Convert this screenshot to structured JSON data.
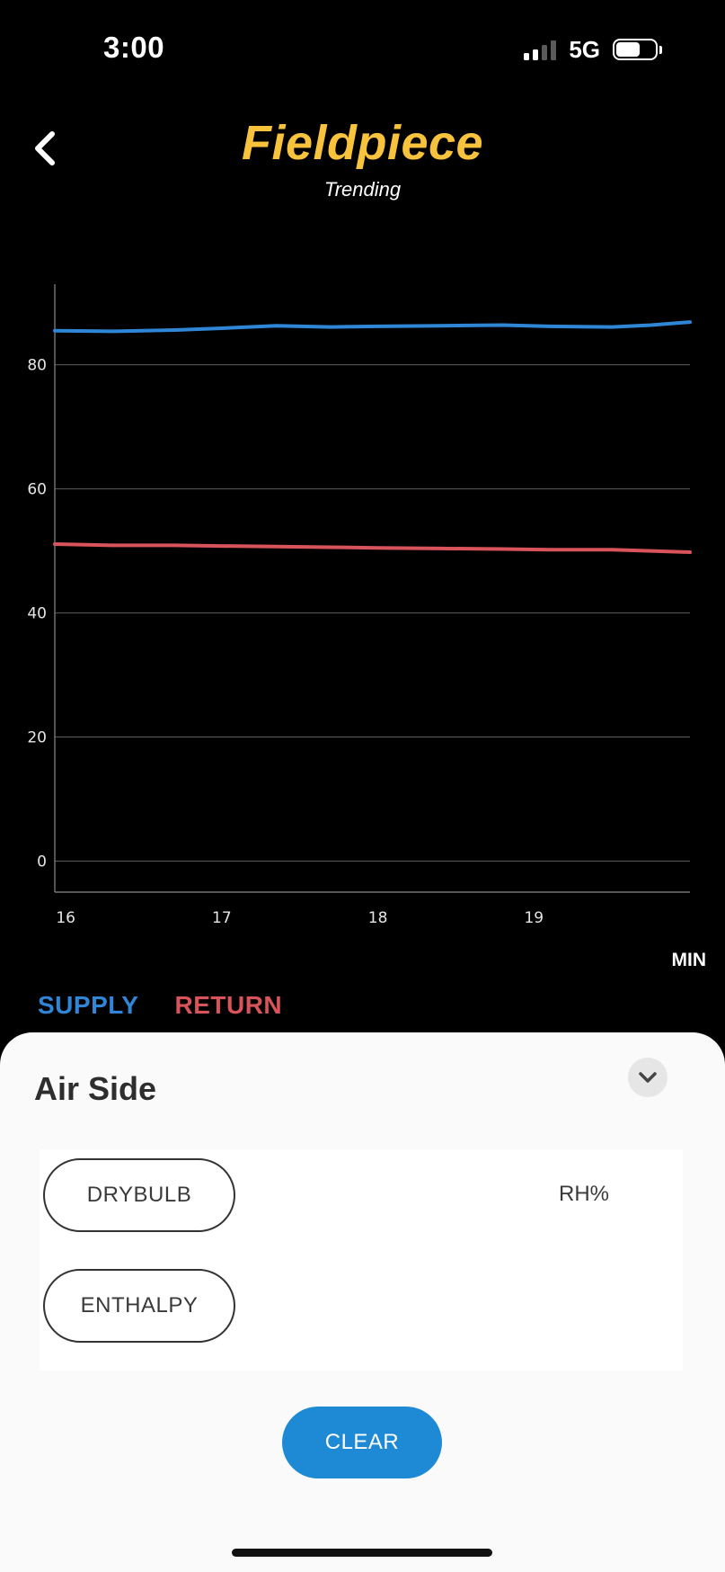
{
  "status_bar": {
    "time": "3:00",
    "network": "5G"
  },
  "header": {
    "brand": "Fieldpiece",
    "subtitle": "Trending"
  },
  "chart_data": {
    "type": "line",
    "x_unit_label": "MIN",
    "xlim": [
      15.93,
      20.0
    ],
    "ylim": [
      -5,
      93
    ],
    "y_ticks": [
      0,
      20,
      40,
      60,
      80
    ],
    "x_ticks": [
      16,
      17,
      18,
      19
    ],
    "grid": true,
    "legend": "bottom-left",
    "series": [
      {
        "name": "SUPPLY",
        "color": "#2f86d6",
        "x": [
          15.93,
          16.3,
          16.7,
          17.0,
          17.35,
          17.7,
          18.0,
          18.4,
          18.8,
          19.1,
          19.5,
          19.75,
          20.0
        ],
        "y": [
          85.5,
          85.4,
          85.6,
          85.9,
          86.3,
          86.1,
          86.2,
          86.3,
          86.4,
          86.2,
          86.1,
          86.4,
          86.9
        ]
      },
      {
        "name": "RETURN",
        "color": "#d9535a",
        "x": [
          15.93,
          16.3,
          16.7,
          17.0,
          17.35,
          17.7,
          18.0,
          18.4,
          18.8,
          19.1,
          19.5,
          19.75,
          20.0
        ],
        "y": [
          51.1,
          50.9,
          50.9,
          50.8,
          50.7,
          50.6,
          50.5,
          50.4,
          50.3,
          50.2,
          50.2,
          50.0,
          49.8
        ]
      }
    ]
  },
  "legend": {
    "supply_label": "SUPPLY",
    "return_label": "RETURN"
  },
  "panel": {
    "title": "Air Side",
    "options": {
      "drybulb": "DRYBULB",
      "enthalpy": "ENTHALPY",
      "rh": "RH%"
    },
    "clear_label": "CLEAR"
  },
  "colors": {
    "brand": "#f7c23c",
    "supply": "#2f86d6",
    "return": "#d9535a",
    "clear_button": "#1e8ad6"
  },
  "icons": {
    "back": "chevron-left-icon",
    "collapse": "chevron-down-icon"
  }
}
